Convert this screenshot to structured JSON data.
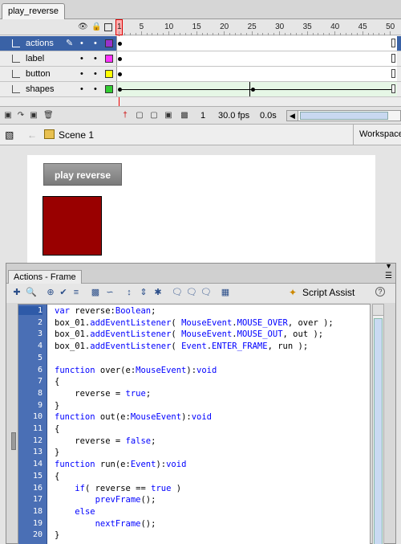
{
  "document_tab": "play_reverse",
  "timeline": {
    "ruler_numbers": [
      "1",
      "5",
      "10",
      "15",
      "20",
      "25",
      "30",
      "35",
      "40",
      "45",
      "50"
    ],
    "current_frame": "1",
    "layers": [
      {
        "name": "actions",
        "color": "#9933cc",
        "selected": true,
        "keyframes": [
          1
        ]
      },
      {
        "name": "label",
        "color": "#ff33ff",
        "selected": false,
        "keyframes": [
          1
        ]
      },
      {
        "name": "button",
        "color": "#ffff00",
        "selected": false,
        "keyframes": [
          1
        ]
      },
      {
        "name": "shapes",
        "color": "#33cc33",
        "selected": false,
        "keyframes": [
          1,
          25
        ]
      }
    ],
    "status": {
      "frame": "1",
      "fps": "30.0 fps",
      "time": "0.0s"
    }
  },
  "editbar": {
    "scene": "Scene 1",
    "workspace": "Workspace"
  },
  "stage": {
    "button_label": "play reverse",
    "box_color": "#990000"
  },
  "actions_panel": {
    "tab_label": "Actions - Frame",
    "script_assist": "Script Assist",
    "code_lines": [
      "var reverse:Boolean;",
      "box_01.addEventListener( MouseEvent.MOUSE_OVER, over );",
      "box_01.addEventListener( MouseEvent.MOUSE_OUT, out );",
      "box_01.addEventListener( Event.ENTER_FRAME, run );",
      "",
      "function over(e:MouseEvent):void",
      "{",
      "    reverse = true;",
      "}",
      "function out(e:MouseEvent):void",
      "{",
      "    reverse = false;",
      "}",
      "function run(e:Event):void",
      "{",
      "    if( reverse == true )",
      "        prevFrame();",
      "    else",
      "        nextFrame();",
      "}"
    ]
  }
}
